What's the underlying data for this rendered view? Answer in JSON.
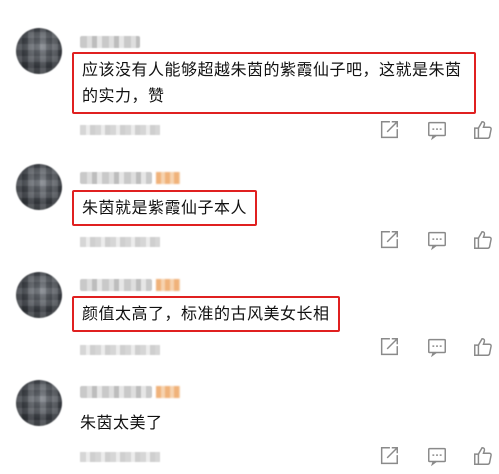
{
  "comments": [
    {
      "text": "应该没有人能够超越朱茵的紫霞仙子吧，这就是朱茵的实力，赞",
      "highlighted": true
    },
    {
      "text": "朱茵就是紫霞仙子本人",
      "highlighted": true
    },
    {
      "text": "颜值太高了，标准的古风美女长相",
      "highlighted": true
    },
    {
      "text": "朱茵太美了",
      "highlighted": false
    }
  ],
  "icons": {
    "share": "share-icon",
    "comment": "comment-icon",
    "like": "thumbs-up-icon"
  },
  "colors": {
    "highlight_border": "#e02020",
    "icon": "#8a8a8a"
  }
}
